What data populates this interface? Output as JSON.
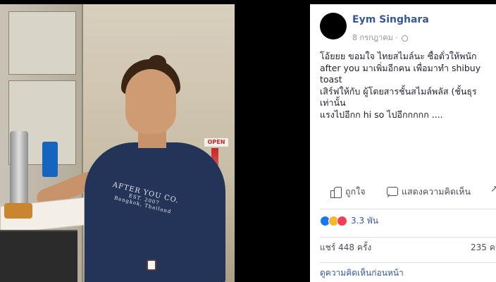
{
  "post": {
    "author": "Eym Singhara",
    "date": "8 กรกฎาคม ·",
    "lines": [
      "โอ้ยยย ขอมใจ ไทยสไมล์นะ ซื้อตั๋วให้พนัก",
      "after you มาเพิ่มอีกคน เพื่อมาทำ shibuy",
      "toast",
      "เสิร์ฟให้กับ ผู้โดยสารชั้นสไมล์พลัส (ชั้นธุร",
      "เท่านั้น",
      "แรงไปอีกก hi so ไปอีกกกกก ...."
    ],
    "actions": {
      "like": "ถูกใจ",
      "comment": "แสดงความคิดเห็น"
    },
    "reactions_count": "3.3 พัน",
    "shares": "แชร์ 448 ครั้ง",
    "comments_count": "235 คร",
    "view_previous": "ดูความคิดเห็นก่อนหน้า"
  },
  "photo": {
    "shirt_print_line1": "AFTER YOU CO.",
    "shirt_print_line2": "EST. 2007",
    "shirt_print_line3": "Bangkok, Thailand",
    "sign_text": "OPEN"
  },
  "colors": {
    "link": "#365899",
    "like": "#1877f2",
    "wow": "#f7b928",
    "love": "#f33e58"
  }
}
